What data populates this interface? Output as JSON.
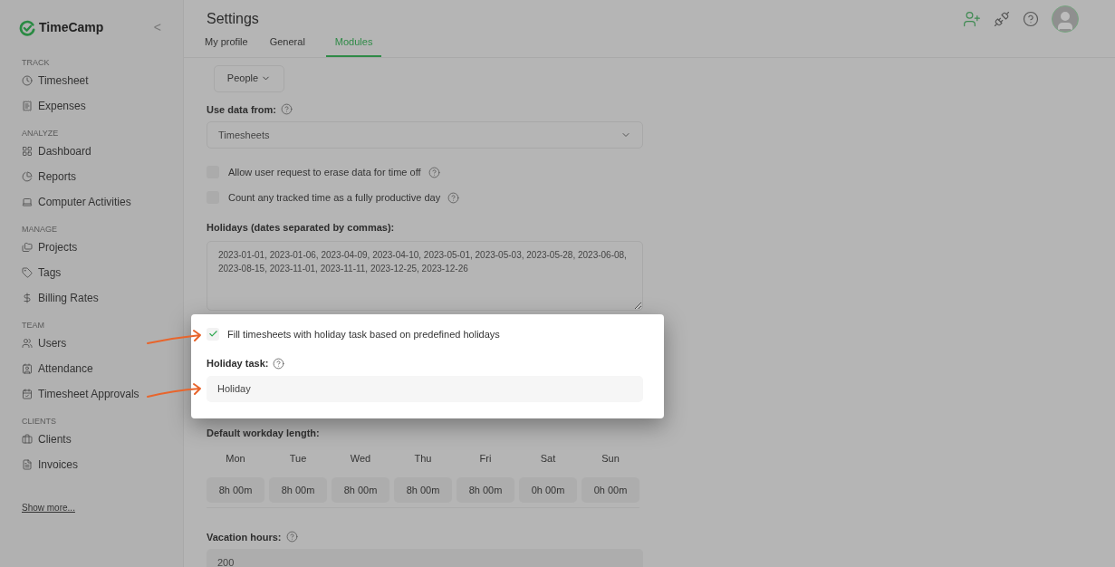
{
  "sidebar": {
    "brand": "TimeCamp",
    "collapse": "<",
    "sections": [
      {
        "title": "TRACK",
        "items": [
          "Timesheet",
          "Expenses"
        ]
      },
      {
        "title": "ANALYZE",
        "items": [
          "Dashboard",
          "Reports",
          "Computer Activities"
        ]
      },
      {
        "title": "MANAGE",
        "items": [
          "Projects",
          "Tags",
          "Billing Rates"
        ]
      },
      {
        "title": "TEAM",
        "items": [
          "Users",
          "Attendance",
          "Timesheet Approvals"
        ]
      },
      {
        "title": "CLIENTS",
        "items": [
          "Clients",
          "Invoices"
        ]
      }
    ],
    "show_more": "Show more..."
  },
  "page_title": "Settings",
  "tabs": [
    {
      "label": "My profile",
      "selected": false
    },
    {
      "label": "General",
      "selected": false
    },
    {
      "label": "Modules",
      "selected": true
    }
  ],
  "module_dropdown": "People",
  "use_data_from": {
    "label": "Use data from:",
    "value": "Timesheets"
  },
  "options": [
    {
      "label": "Allow user request to erase data for time off",
      "checked": false
    },
    {
      "label": "Count any tracked time as a fully productive day",
      "checked": false
    }
  ],
  "holidays": {
    "label": "Holidays (dates separated by commas):",
    "value": "2023-01-01, 2023-01-06, 2023-04-09, 2023-04-10, 2023-05-01, 2023-05-03, 2023-05-28, 2023-06-08, 2023-08-15, 2023-11-01, 2023-11-11, 2023-12-25, 2023-12-26"
  },
  "highlight": {
    "fill_option": {
      "label": "Fill timesheets with holiday task based on predefined holidays",
      "checked": true
    },
    "holiday_task": {
      "label": "Holiday task:",
      "value": "Holiday"
    }
  },
  "workday": {
    "label": "Default workday length:",
    "days": [
      {
        "day": "Mon",
        "value": "8h 00m"
      },
      {
        "day": "Tue",
        "value": "8h 00m"
      },
      {
        "day": "Wed",
        "value": "8h 00m"
      },
      {
        "day": "Thu",
        "value": "8h 00m"
      },
      {
        "day": "Fri",
        "value": "8h 00m"
      },
      {
        "day": "Sat",
        "value": "0h 00m"
      },
      {
        "day": "Sun",
        "value": "0h 00m"
      }
    ]
  },
  "vacation": {
    "label": "Vacation hours:",
    "value": "200"
  }
}
